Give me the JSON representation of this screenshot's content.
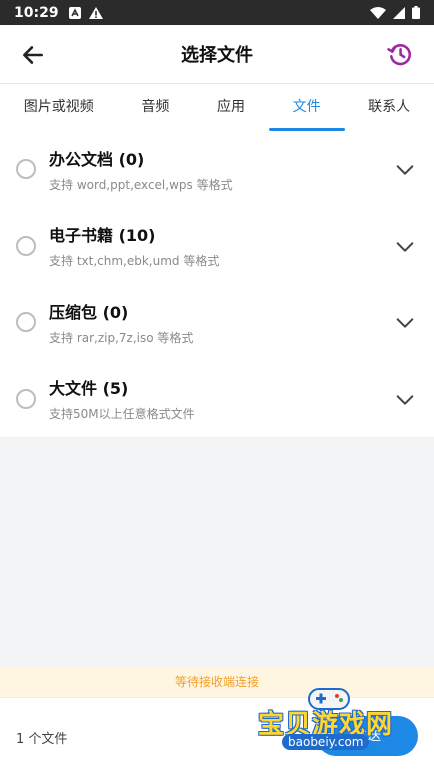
{
  "status_bar": {
    "time": "10:29"
  },
  "app_bar": {
    "title": "选择文件"
  },
  "tabs": [
    {
      "label": "图片或视频",
      "active": false
    },
    {
      "label": "音频",
      "active": false
    },
    {
      "label": "应用",
      "active": false
    },
    {
      "label": "文件",
      "active": true
    },
    {
      "label": "联系人",
      "active": false
    }
  ],
  "items": [
    {
      "title": "办公文档 (0)",
      "subtitle": "支持 word,ppt,excel,wps 等格式"
    },
    {
      "title": "电子书籍 (10)",
      "subtitle": "支持 txt,chm,ebk,umd 等格式"
    },
    {
      "title": "压缩包 (0)",
      "subtitle": "支持 rar,zip,7z,iso 等格式"
    },
    {
      "title": "大文件 (5)",
      "subtitle": "支持50M以上任意格式文件"
    }
  ],
  "waiting_text": "等待接收端连接",
  "bottom": {
    "count": "1 个文件",
    "send_label": "发送"
  },
  "watermark": {
    "text": "宝贝游戏网",
    "url": "baobeiy.com"
  },
  "colors": {
    "accent": "#1e88e5",
    "history_icon": "#9c2aa0",
    "waiting_bg": "#fff6e1",
    "waiting_text": "#f29f2a"
  }
}
